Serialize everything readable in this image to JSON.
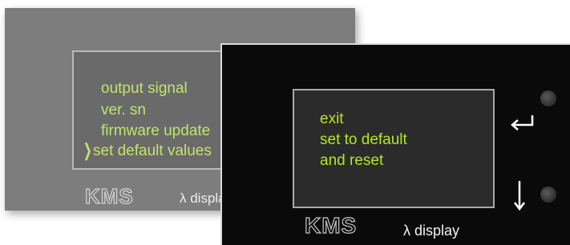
{
  "back_display": {
    "menu_items": [
      "output signal",
      "ver. sn",
      "firmware update",
      "set default values"
    ],
    "selected_index": 3,
    "selection_marker": "❯",
    "brand": "KMS",
    "model": "λ display"
  },
  "front_display": {
    "menu_lines": [
      "exit",
      "set to default",
      "and reset"
    ],
    "brand": "KMS",
    "model": "λ display",
    "buttons": [
      {
        "name": "enter",
        "icon": "enter-arrow-icon"
      },
      {
        "name": "down",
        "icon": "down-arrow-icon"
      }
    ]
  },
  "colors": {
    "back_text": "#c5e36a",
    "front_text": "#b9e51f",
    "front_body": "#0a0a0a",
    "back_body": "#7d7d7d"
  }
}
